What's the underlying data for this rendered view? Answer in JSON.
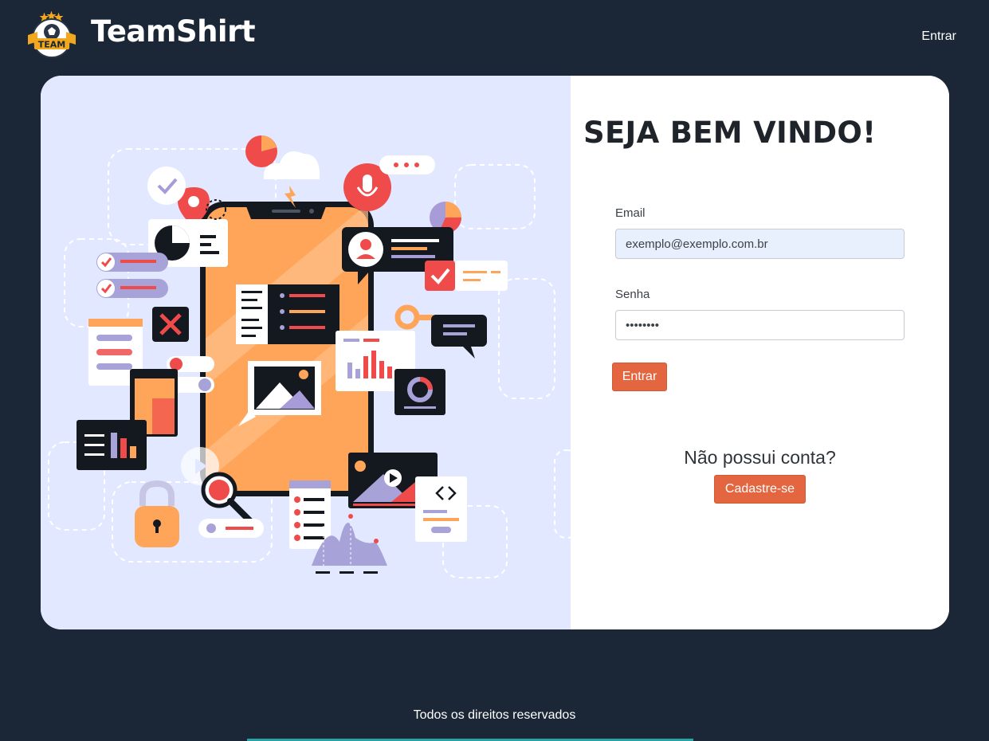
{
  "header": {
    "logo_text": "TEAM",
    "brand": "TeamShirt",
    "nav_login": "Entrar"
  },
  "login": {
    "title": "SEJA BEM VINDO!",
    "email_label": "Email",
    "email_value": "exemplo@exemplo.com.br",
    "password_label": "Senha",
    "password_value": "••••••••",
    "submit_label": "Entrar",
    "no_account_text": "Não possui conta?",
    "signup_label": "Cadastre-se"
  },
  "footer": {
    "text": "Todos os direitos reservados"
  },
  "colors": {
    "background": "#1b2636",
    "accent": "#e46641",
    "illustration_bg": "#e2e8ff",
    "phone_orange": "#fea559"
  },
  "icons": {
    "illustration": "mobile-apps-illustration",
    "logo": "team-shield-logo"
  }
}
